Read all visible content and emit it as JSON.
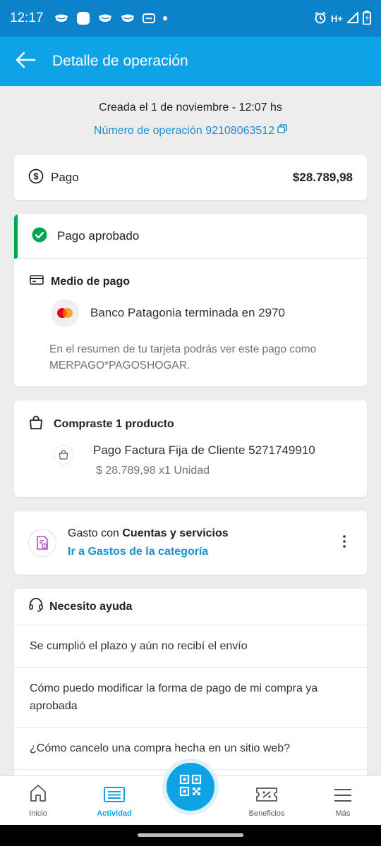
{
  "status_bar": {
    "time": "12:17",
    "network": "H+"
  },
  "header": {
    "title": "Detalle de operación"
  },
  "operation": {
    "created": "Creada el 1 de noviembre - 12:07 hs",
    "number": "Número de operación 92108063512"
  },
  "payment": {
    "label": "Pago",
    "amount": "$28.789,98"
  },
  "approval": {
    "status": "Pago aprobado",
    "method_title": "Medio de pago",
    "bank": "Banco Patagonia terminada en 2970",
    "statement_note": "En el resumen de tu tarjeta podrás ver este pago como MERPAGO*PAGOSHOGAR."
  },
  "purchase": {
    "title": "Compraste 1 producto",
    "product_name": "Pago Factura Fija de Cliente 5271749910",
    "product_price": "$ 28.789,98 x1 Unidad"
  },
  "category": {
    "prefix": "Gasto con ",
    "name": "Cuentas y servicios",
    "link": "Ir a Gastos de la categoría"
  },
  "help": {
    "title": "Necesito ayuda",
    "items": [
      "Se cumplió el plazo y aún no recibí el envío",
      "Cómo puedo modificar la forma de pago de mi compra ya aprobada",
      "¿Cómo cancelo una compra hecha en un sitio web?"
    ]
  },
  "bottom_nav": {
    "items": [
      {
        "label": "Inicio",
        "icon": "home-icon"
      },
      {
        "label": "Actividad",
        "icon": "activity-icon",
        "active": true
      },
      {
        "label": "",
        "icon": "qr-icon"
      },
      {
        "label": "Beneficios",
        "icon": "ticket-icon"
      },
      {
        "label": "Más",
        "icon": "menu-icon"
      }
    ]
  },
  "colors": {
    "primary": "#0ea3e6",
    "status_bar": "#0b82c9",
    "success": "#00a650",
    "link": "#1a8fd1",
    "background": "#ededed"
  }
}
